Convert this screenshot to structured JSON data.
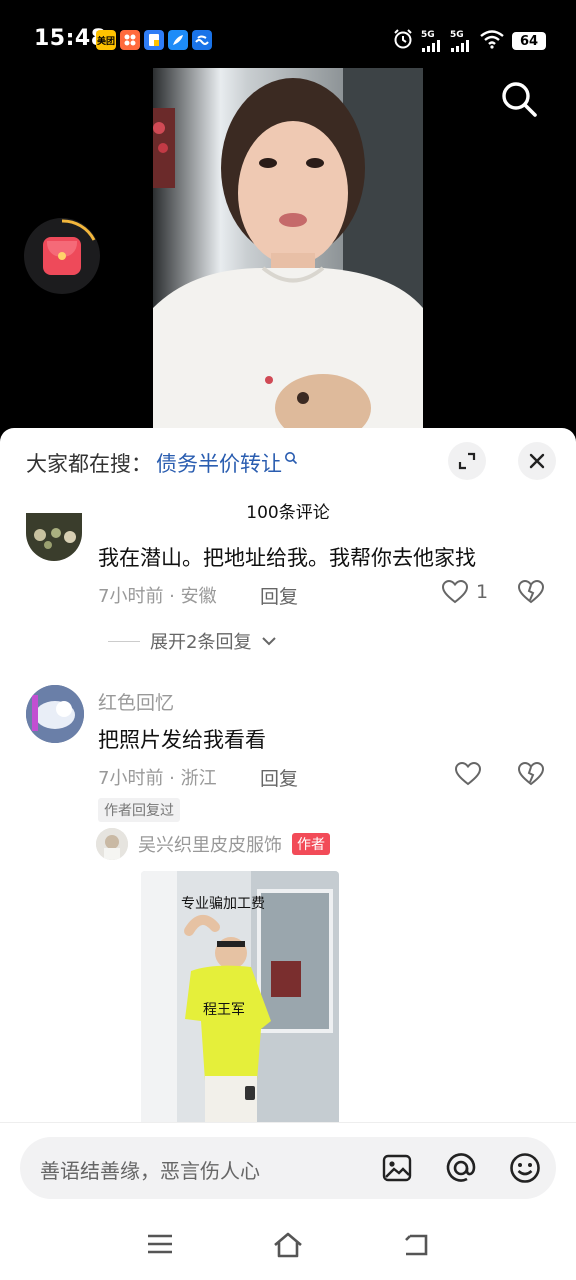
{
  "status_bar": {
    "time": "15:48",
    "app_icons": [
      {
        "name": "meituan-icon",
        "label": "美团",
        "color": "#ffc300"
      },
      {
        "name": "grid-app-icon",
        "label": "",
        "color": "#ff6a3d"
      },
      {
        "name": "doc-app-icon",
        "label": "",
        "color": "#2f7df6"
      },
      {
        "name": "feather-app-icon",
        "label": "",
        "color": "#1d8cf8"
      },
      {
        "name": "wave-app-icon",
        "label": "",
        "color": "#1a73e8"
      }
    ],
    "signal_1": "5G",
    "signal_2": "5G",
    "battery": "64"
  },
  "hot_search": {
    "prefix": "大家都在搜：",
    "term": "债务半价转让"
  },
  "comments_header": {
    "title": "100条评论"
  },
  "comments": [
    {
      "text": "我在潜山。把地址给我。我帮你去他家找",
      "time": "7小时前",
      "location": "安徽",
      "reply_label": "回复",
      "likes": "1",
      "expand_label": "展开2条回复"
    },
    {
      "username": "红色回忆",
      "text": "把照片发给我看看",
      "time": "7小时前",
      "location": "浙江",
      "reply_label": "回复",
      "author_replied": "作者回复过",
      "reply": {
        "username": "吴兴织里皮皮服饰",
        "badge": "作者",
        "image_caption": "专业骗加工费",
        "image_label": "程王军"
      }
    }
  ],
  "input": {
    "placeholder": "善语结善缘，恶言伤人心"
  },
  "colors": {
    "accent_link": "#2a5db0",
    "author_badge": "#f24b58",
    "redpacket": "#ee4a5a"
  }
}
